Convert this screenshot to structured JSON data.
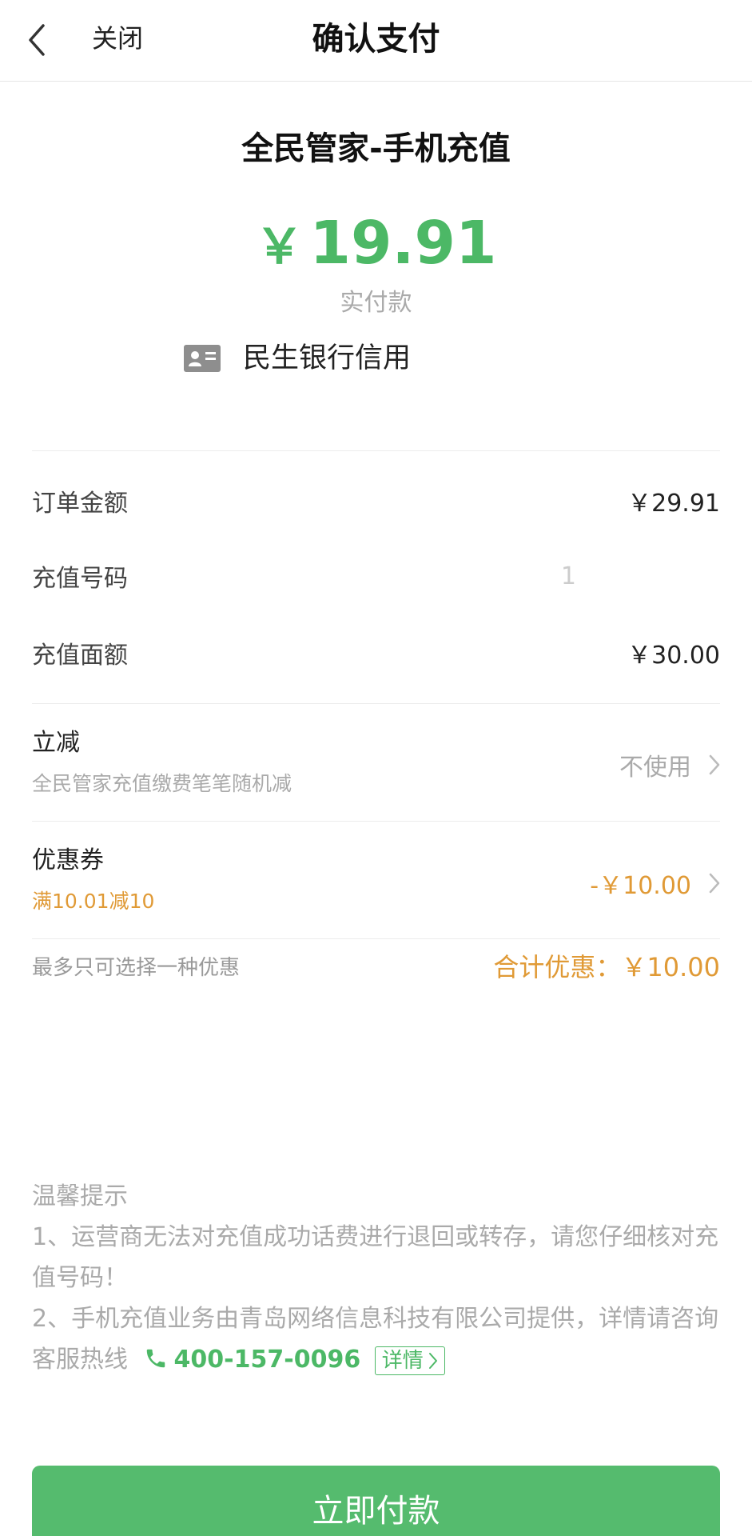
{
  "header": {
    "close_label": "关闭",
    "title": "确认支付"
  },
  "merchant": {
    "name": "全民管家-手机充值",
    "currency_symbol": "￥",
    "amount": "19.91",
    "amount_label": "实付款",
    "payment_method": "民生银行信用"
  },
  "details": [
    {
      "label": "订单金额",
      "value": "￥29.91"
    },
    {
      "label": "充值号码",
      "value": "1"
    },
    {
      "label": "充值面额",
      "value": "￥30.00"
    }
  ],
  "instant_discount": {
    "title": "立减",
    "subtitle": "全民管家充值缴费笔笔随机减",
    "value": "不使用"
  },
  "coupon": {
    "title": "优惠券",
    "subtitle": "满10.01减10",
    "value": "-￥10.00"
  },
  "summary": {
    "note": "最多只可选择一种优惠",
    "total_discount": "合计优惠：￥10.00"
  },
  "tips": {
    "heading": "温馨提示",
    "line1": "1、运营商无法对充值成功话费进行退回或转存，请您仔细核对充值号码！",
    "line2": "2、手机充值业务由青岛网络信息科技有限公司提供，详情请咨询客服热线",
    "phone": "400-157-0096",
    "detail_label": "详情"
  },
  "pay_button": "立即付款",
  "colors": {
    "accent_green": "#4cb866",
    "discount_orange": "#e09a36"
  },
  "icons": [
    "chevron-left-icon",
    "bank-card-icon",
    "chevron-right-icon",
    "phone-icon"
  ]
}
